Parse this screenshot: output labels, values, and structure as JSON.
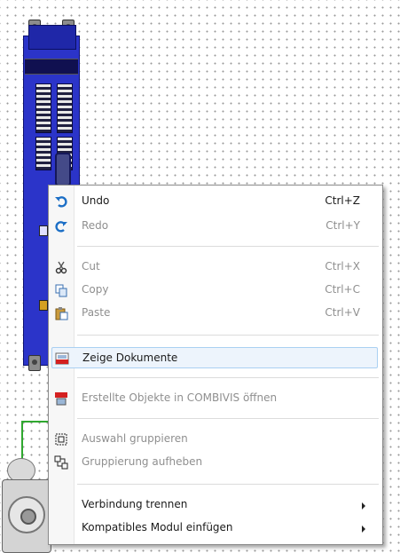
{
  "menu": {
    "undo": {
      "label": "Undo",
      "shortcut": "Ctrl+Z",
      "icon": "undo-icon",
      "enabled": true
    },
    "redo": {
      "label": "Redo",
      "shortcut": "Ctrl+Y",
      "icon": "redo-icon",
      "enabled": false
    },
    "cut": {
      "label": "Cut",
      "shortcut": "Ctrl+X",
      "icon": "scissors-icon",
      "enabled": false
    },
    "copy": {
      "label": "Copy",
      "shortcut": "Ctrl+C",
      "icon": "copy-icon",
      "enabled": false
    },
    "paste": {
      "label": "Paste",
      "shortcut": "Ctrl+V",
      "icon": "paste-icon",
      "enabled": false
    },
    "show_docs": {
      "label": "Zeige Dokumente",
      "icon": "documents-icon",
      "enabled": true,
      "highlighted": true
    },
    "open_in_combivis": {
      "label": "Erstellte Objekte in COMBIVIS öffnen",
      "icon": "combivis-icon",
      "enabled": false
    },
    "group": {
      "label": "Auswahl gruppieren",
      "icon": "group-icon",
      "enabled": false
    },
    "ungroup": {
      "label": "Gruppierung aufheben",
      "icon": "ungroup-icon",
      "enabled": false
    },
    "disconnect": {
      "label": "Verbindung trennen",
      "submenu": true,
      "enabled": true
    },
    "insert_module": {
      "label": "Kompatibles Modul einfügen",
      "submenu": true,
      "enabled": true
    }
  },
  "colors": {
    "module_blue": "#2b34c9",
    "wire_green": "#2fa82f",
    "highlight_bg": "#edf4fc",
    "highlight_border": "#aad0f2",
    "disabled_text": "#8f8f8f"
  }
}
